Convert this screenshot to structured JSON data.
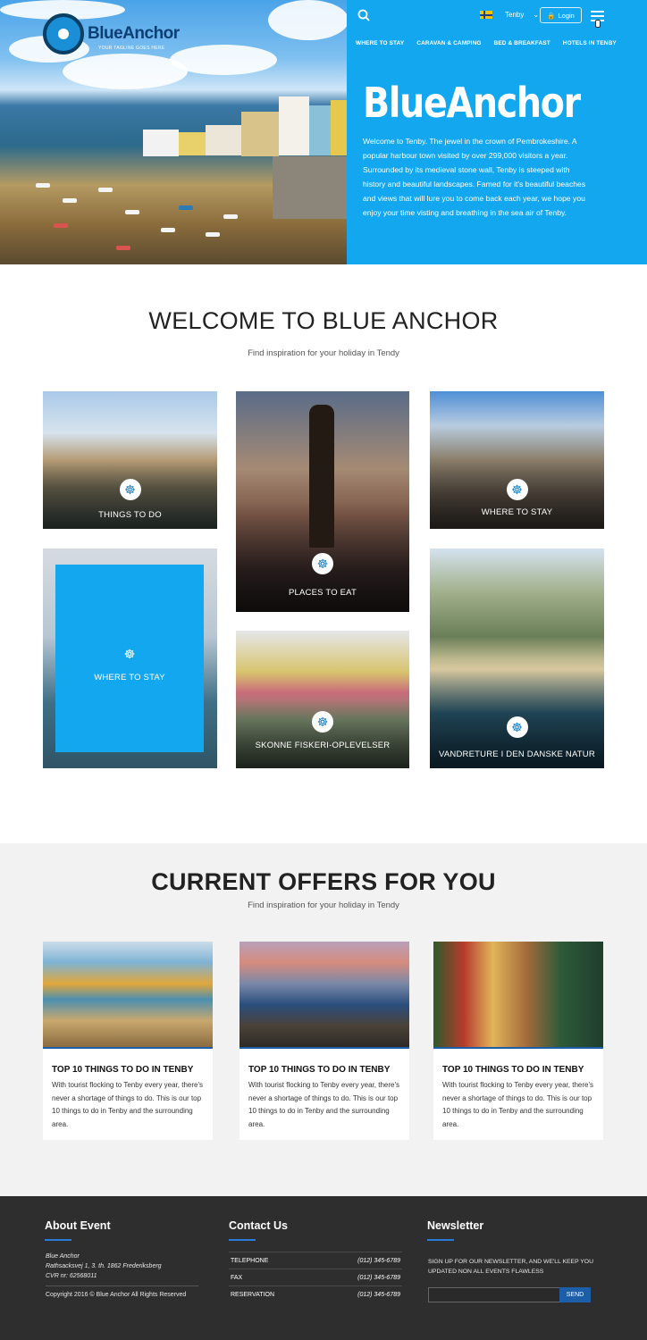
{
  "header": {
    "logo_text": "BlueAnchor",
    "logo_tagline": "YOUR TAGLINE GOES HERE",
    "language": "Tenby",
    "login_label": "Login",
    "nav": [
      "WHERE TO STAY",
      "CARAVAN & CAMPING",
      "BED & BREAKFAST",
      "HOTELS IN TENBY"
    ],
    "brand_title": "BlueAnchor",
    "intro": "Welcome to Tenby. The jewel in the crown of Pembrokeshire. A popular harbour town visited by over 299,000 visitors a year. Surrounded by its medieval stone wall, Tenby is steeped with history and beautiful landscapes. Famed for it's beautiful beaches and views that will lure you to come back each year, we hope you enjoy your time visting and breathing in the sea air of Tenby.",
    "accent_color": "#12a7ee"
  },
  "welcome": {
    "title": "WELCOME TO BLUE ANCHOR",
    "subtitle": "Find inspiration for your holiday in Tendy",
    "tiles": [
      {
        "label": "THINGS TO DO"
      },
      {
        "label": "PLACES TO EAT"
      },
      {
        "label": "WHERE TO STAY"
      },
      {
        "label": "WHERE TO STAY"
      },
      {
        "label": "SKONNE FISKERI-OPLEVELSER"
      },
      {
        "label": "VANDRETURE I DEN DANSKE NATUR"
      }
    ],
    "tile_icon": "ship-wheel-icon"
  },
  "offers": {
    "title": "CURRENT OFFERS FOR YOU",
    "subtitle": "Find inspiration for your holiday in Tendy",
    "cards": [
      {
        "title": "TOP 10 THINGS TO DO IN TENBY",
        "text": "With tourist flocking to Tenby every year, there's never a shortage of things to do. This is our top 10 things to do in Tenby and the surrounding area."
      },
      {
        "title": "TOP 10 THINGS TO DO IN TENBY",
        "text": "With tourist flocking to Tenby every year, there's never a shortage of things to do. This is our top 10 things to do in Tenby and the surrounding area."
      },
      {
        "title": "TOP 10 THINGS TO DO IN TENBY",
        "text": "With tourist flocking to Tenby every year, there's never a shortage of things to do. This is our top 10 things to do in Tenby and the surrounding area."
      }
    ]
  },
  "footer": {
    "about": {
      "heading": "About Event",
      "name": "Blue Anchor",
      "address": "Rathsacksvej 1, 3. th. 1862 Frederiksberg",
      "cvr": "CVR nr: 62568011",
      "copyright": "Copyright 2016  © Blue Anchor  All Rights Reserved"
    },
    "contact": {
      "heading": "Contact Us",
      "rows": [
        {
          "label": "TELEPHONE",
          "value": "(012) 345-6789"
        },
        {
          "label": "FAX",
          "value": "(012) 345-6789"
        },
        {
          "label": "RESERVATION",
          "value": "(012) 345-6789"
        }
      ]
    },
    "newsletter": {
      "heading": "Newsletter",
      "text": "SIGN UP FOR OUR NEWSLETTER, AND WE'LL KEEP YOU UPDATED NON ALL  EVENTS FLAWLESS",
      "send_label": "SEND"
    }
  }
}
